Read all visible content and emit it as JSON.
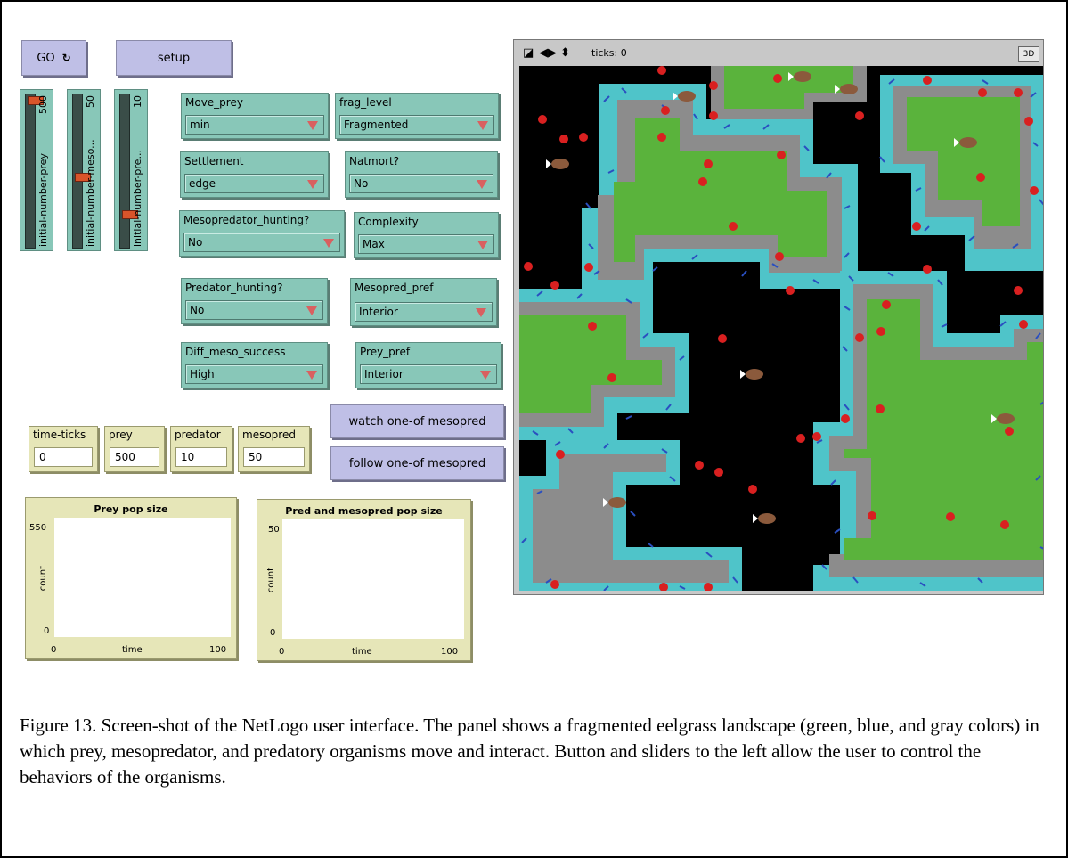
{
  "buttons": {
    "go": "GO",
    "setup": "setup",
    "watch": "watch one-of mesopred",
    "follow": "follow one-of mesopred"
  },
  "sliders": [
    {
      "label": "initial-number-prey",
      "value": "500",
      "fraction": 0.02
    },
    {
      "label": "initial-number-meso...",
      "value": "50",
      "fraction": 0.5
    },
    {
      "label": "initial-number-pre...",
      "value": "10",
      "fraction": 0.75
    }
  ],
  "choosers": {
    "move_prey": {
      "title": "Move_prey",
      "value": "min"
    },
    "frag_level": {
      "title": "frag_level",
      "value": "Fragmented"
    },
    "settlement": {
      "title": "Settlement",
      "value": "edge"
    },
    "natmort": {
      "title": "Natmort?",
      "value": "No"
    },
    "meso_hunting": {
      "title": "Mesopredator_hunting?",
      "value": "No"
    },
    "complexity": {
      "title": "Complexity",
      "value": "Max"
    },
    "pred_hunting": {
      "title": "Predator_hunting?",
      "value": "No"
    },
    "mesopred_pref": {
      "title": "Mesopred_pref",
      "value": "Interior"
    },
    "diff_meso": {
      "title": "Diff_meso_success",
      "value": "High"
    },
    "prey_pref": {
      "title": "Prey_pref",
      "value": "Interior"
    }
  },
  "monitors": {
    "time_ticks": {
      "title": "time-ticks",
      "value": "0"
    },
    "prey": {
      "title": "prey",
      "value": "500"
    },
    "predator": {
      "title": "predator",
      "value": "10"
    },
    "mesopred": {
      "title": "mesopred",
      "value": "50"
    }
  },
  "plots": {
    "prey": {
      "title": "Prey pop size",
      "ymax": "550",
      "ymin": "0",
      "xmin": "0",
      "xmax": "100",
      "xlabel": "time",
      "ylabel": "count"
    },
    "pred": {
      "title": "Pred and mesopred pop size",
      "ymax": "50",
      "ymin": "0",
      "xmin": "0",
      "xmax": "100",
      "xlabel": "time",
      "ylabel": "count"
    }
  },
  "view": {
    "ticks_label": "ticks: 0",
    "btn3d": "3D"
  },
  "colors": {
    "seagrass": "#5ab33c",
    "edge_blue": "#4fc4c9",
    "bare_gray": "#8c8c8c",
    "water": "#000000",
    "mesopred_red": "#d92020",
    "predator_fish": "#8b5a3c"
  },
  "caption": "Figure 13.  Screen-shot of the NetLogo user interface.  The panel shows a fragmented eelgrass landscape (green, blue, and gray colors) in which prey, mesopredator, and predatory organisms move and interact.  Button and sliders to the left allow the user to control the behaviors of the organisms."
}
